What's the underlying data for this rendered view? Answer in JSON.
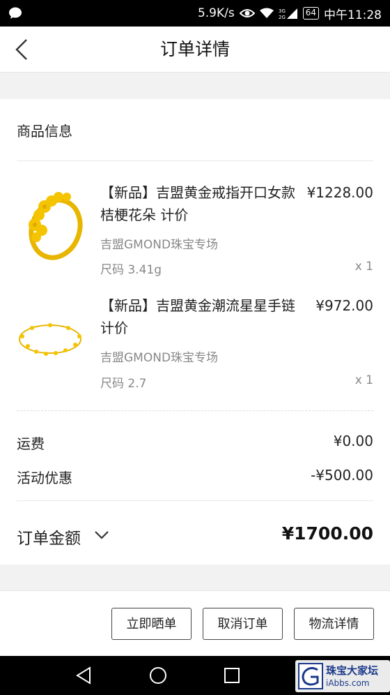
{
  "status_bar": {
    "speed": "5.9K/s",
    "battery": "64",
    "time": "中午11:28",
    "icons": [
      "message-icon",
      "eye-icon",
      "wifi-icon",
      "signal-icon",
      "battery-icon"
    ]
  },
  "header": {
    "title": "订单详情",
    "back_icon": "chevron-left-icon"
  },
  "product_section": {
    "title": "商品信息",
    "items": [
      {
        "name": "【新品】吉盟黄金戒指开口女款桔梗花朵 计价",
        "price": "¥1228.00",
        "shop": "吉盟GMOND珠宝专场",
        "size": "尺码 3.41g",
        "qty": "x 1",
        "thumb_icon": "gold-ring-image"
      },
      {
        "name": "【新品】吉盟黄金潮流星星手链 计价",
        "price": "¥972.00",
        "shop": "吉盟GMOND珠宝专场",
        "size": "尺码 2.7",
        "qty": "x 1",
        "thumb_icon": "gold-bracelet-image"
      }
    ]
  },
  "fees": {
    "shipping_label": "运费",
    "shipping_value": "¥0.00",
    "discount_label": "活动优惠",
    "discount_value": "-¥500.00"
  },
  "total": {
    "label": "订单金额",
    "amount": "¥1700.00",
    "expand_icon": "chevron-down-icon"
  },
  "actions": {
    "share_order": "立即晒单",
    "cancel_order": "取消订单",
    "logistics": "物流详情"
  },
  "system_nav": {
    "icons": [
      "back-triangle-icon",
      "home-circle-icon",
      "recents-square-icon"
    ]
  },
  "watermark": {
    "line1": "珠宝大家坛",
    "line2": "iAbbs.com"
  },
  "colors": {
    "gold": "#f5c400",
    "page_bg": "#f2f2f2",
    "border": "#444444"
  }
}
